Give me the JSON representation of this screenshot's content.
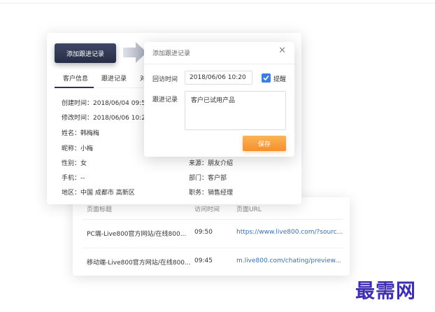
{
  "colors": {
    "primary_dark": "#2c3350",
    "save_orange": "#f68f2f",
    "checkbox_blue": "#3b7ee0",
    "link_blue": "#3b6fa8",
    "watermark": "#3f2fb0"
  },
  "add_button": {
    "label": "添加跟进记录"
  },
  "tabs": [
    {
      "label": "客户信息",
      "active": true
    },
    {
      "label": "跟进记录",
      "active": false
    },
    {
      "label": "对",
      "active": false
    }
  ],
  "info": {
    "created": "创建时间：2018/06/04  09:56",
    "modified": "修改时间：2018/06/06  10:20",
    "name": "姓名：韩梅梅",
    "nickname": "昵称：小梅",
    "gender": "性别：女",
    "phone": "手机：--",
    "region": "地区：中国 成都市 高新区",
    "source": "来源：朋友介绍",
    "department": "部门：客户部",
    "position": "职务：销售经理"
  },
  "dialog": {
    "title": "添加跟进记录",
    "close_icon": "close-icon",
    "visit_time_label": "回访时间",
    "visit_time_value": "2018/06/06  10:20",
    "remind_label": "提醒",
    "remind_checked": true,
    "note_label": "跟进记录",
    "note_value": "客户已试用产品",
    "save_label": "保存"
  },
  "visits": {
    "headers": [
      "页面标题",
      "访问时间",
      "页面URL"
    ],
    "rows": [
      {
        "title": "PC端-Live800官方网站/在线800...",
        "time": "09:50",
        "url": "https://www.live800.com/?sourc..."
      },
      {
        "title": "移动端-Live800官方网站/在线800...",
        "time": "09:45",
        "url": "m.live800.com/chating/preview..."
      }
    ]
  },
  "watermark": "最需网"
}
